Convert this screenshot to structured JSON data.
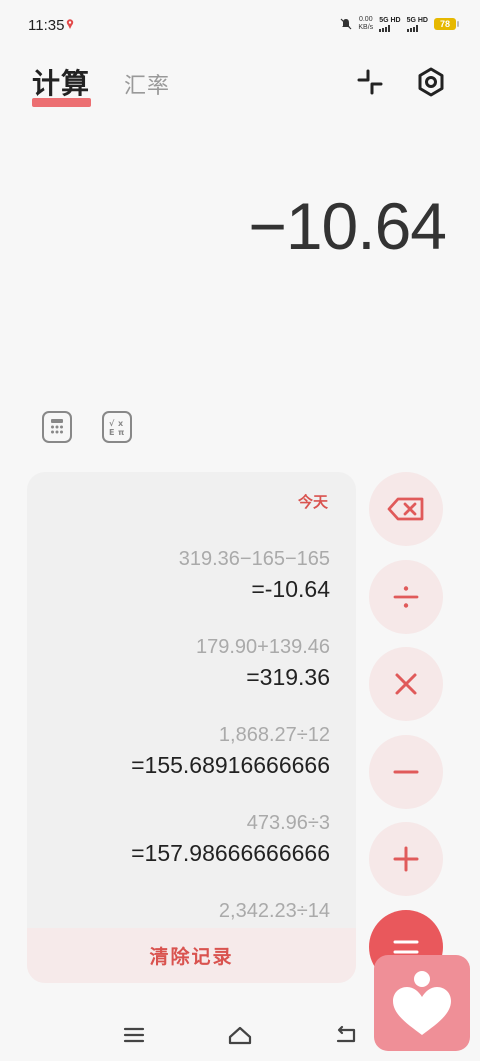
{
  "status_bar": {
    "time": "11:35",
    "net_speed_value": "0.00",
    "net_speed_unit": "KB/s",
    "sim1_label": "5G HD",
    "sim2_label": "5G HD",
    "battery": "78"
  },
  "tabs": {
    "calculate": "计算",
    "exchange": "汇率"
  },
  "display": {
    "result": "−10.64"
  },
  "history": {
    "date_label": "今天",
    "entries": [
      {
        "expression": "319.36−165−165",
        "result": "=-10.64"
      },
      {
        "expression": "179.90+139.46",
        "result": "=319.36"
      },
      {
        "expression": "1,868.27÷12",
        "result": "=155.68916666666"
      },
      {
        "expression": "473.96÷3",
        "result": "=157.98666666666"
      },
      {
        "expression": "2,342.23÷14",
        "result": ""
      }
    ],
    "clear_label": "清除记录"
  },
  "operators": {
    "divide": "÷",
    "multiply": "×",
    "subtract": "−",
    "add": "+",
    "equals": "="
  },
  "colors": {
    "accent": "#e9585c",
    "accent_light": "#f6e8e8",
    "tab_underline": "#ec6f72",
    "floater": "#ef8f97"
  }
}
